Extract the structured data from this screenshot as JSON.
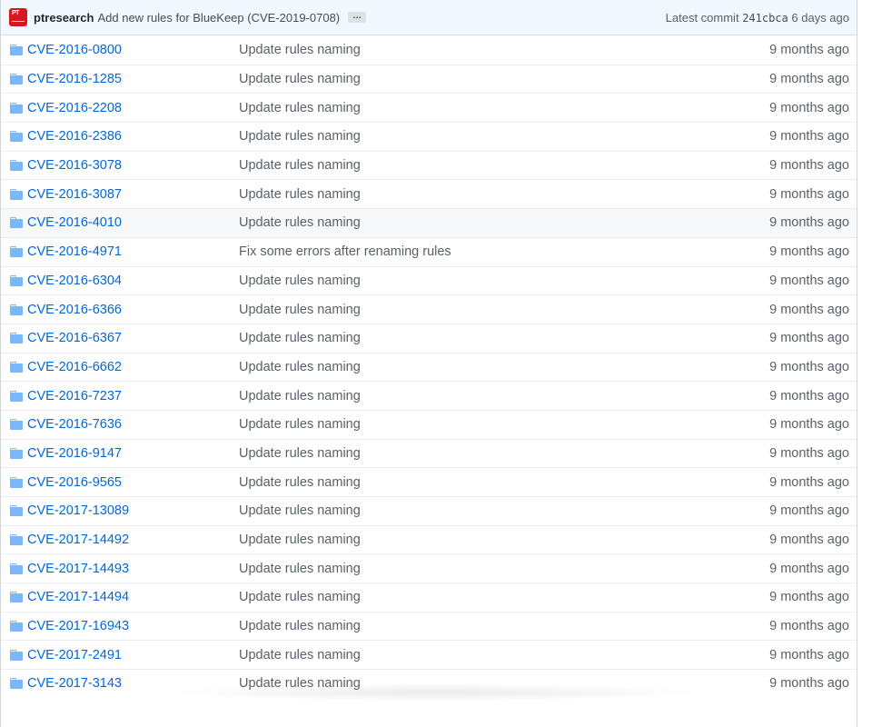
{
  "commit_bar": {
    "author": "ptresearch",
    "message": "Add new rules for BlueKeep (CVE-2019-0708)",
    "ellipsis": "…",
    "latest_label": "Latest commit",
    "sha": "241cbca",
    "age": "6 days ago",
    "avatar_text": "PT"
  },
  "colors": {
    "link": "#0366d6",
    "muted": "#586069",
    "commit_bar_bg": "#f1f8ff",
    "folder": "#79b8ff",
    "avatar": "#d7191f"
  },
  "hover_row_index": 6,
  "rows": [
    {
      "name": "CVE-2016-0800",
      "message": "Update rules naming",
      "age": "9 months ago"
    },
    {
      "name": "CVE-2016-1285",
      "message": "Update rules naming",
      "age": "9 months ago"
    },
    {
      "name": "CVE-2016-2208",
      "message": "Update rules naming",
      "age": "9 months ago"
    },
    {
      "name": "CVE-2016-2386",
      "message": "Update rules naming",
      "age": "9 months ago"
    },
    {
      "name": "CVE-2016-3078",
      "message": "Update rules naming",
      "age": "9 months ago"
    },
    {
      "name": "CVE-2016-3087",
      "message": "Update rules naming",
      "age": "9 months ago"
    },
    {
      "name": "CVE-2016-4010",
      "message": "Update rules naming",
      "age": "9 months ago"
    },
    {
      "name": "CVE-2016-4971",
      "message": "Fix some errors after renaming rules",
      "age": "9 months ago"
    },
    {
      "name": "CVE-2016-6304",
      "message": "Update rules naming",
      "age": "9 months ago"
    },
    {
      "name": "CVE-2016-6366",
      "message": "Update rules naming",
      "age": "9 months ago"
    },
    {
      "name": "CVE-2016-6367",
      "message": "Update rules naming",
      "age": "9 months ago"
    },
    {
      "name": "CVE-2016-6662",
      "message": "Update rules naming",
      "age": "9 months ago"
    },
    {
      "name": "CVE-2016-7237",
      "message": "Update rules naming",
      "age": "9 months ago"
    },
    {
      "name": "CVE-2016-7636",
      "message": "Update rules naming",
      "age": "9 months ago"
    },
    {
      "name": "CVE-2016-9147",
      "message": "Update rules naming",
      "age": "9 months ago"
    },
    {
      "name": "CVE-2016-9565",
      "message": "Update rules naming",
      "age": "9 months ago"
    },
    {
      "name": "CVE-2017-13089",
      "message": "Update rules naming",
      "age": "9 months ago"
    },
    {
      "name": "CVE-2017-14492",
      "message": "Update rules naming",
      "age": "9 months ago"
    },
    {
      "name": "CVE-2017-14493",
      "message": "Update rules naming",
      "age": "9 months ago"
    },
    {
      "name": "CVE-2017-14494",
      "message": "Update rules naming",
      "age": "9 months ago"
    },
    {
      "name": "CVE-2017-16943",
      "message": "Update rules naming",
      "age": "9 months ago"
    },
    {
      "name": "CVE-2017-2491",
      "message": "Update rules naming",
      "age": "9 months ago"
    },
    {
      "name": "CVE-2017-3143",
      "message": "Update rules naming",
      "age": "9 months ago"
    }
  ]
}
